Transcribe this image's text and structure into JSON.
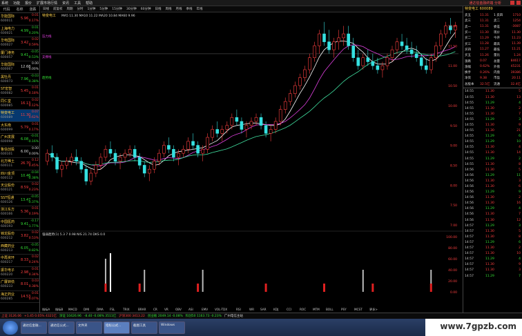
{
  "menubar": {
    "items": [
      "系统",
      "功能",
      "报价",
      "扩展市场行情",
      "资讯",
      "工具",
      "帮助"
    ],
    "brand": "通达信金融终端 分析"
  },
  "left_header": [
    "代码",
    "名称",
    "涨跌"
  ],
  "stocks": [
    {
      "name": "华能国际",
      "code": "600011",
      "price": "5.96",
      "chg": "0.01",
      "pct": "0.17%",
      "dir": "up"
    },
    {
      "name": "上海电力",
      "code": "600021",
      "price": "4.99",
      "chg": "0.01",
      "pct": "0.20%",
      "dir": "dn"
    },
    {
      "name": "华电国际",
      "code": "600027",
      "price": "3.42",
      "chg": "0.02",
      "pct": "0.59%",
      "dir": "up"
    },
    {
      "name": "厦门港务",
      "code": "600057",
      "price": "9.41",
      "chg": "-0.05",
      "pct": "-0.53%",
      "dir": "dn"
    },
    {
      "name": "华能国际",
      "code": "600067",
      "price": "12.68",
      "chg": "0.00",
      "pct": "0.00%",
      "dir": "fl"
    },
    {
      "name": "黑牡丹",
      "code": "600073",
      "price": "7.96",
      "chg": "-0.03",
      "pct": "-0.38%",
      "dir": "dn"
    },
    {
      "name": "ST宏智",
      "code": "600082",
      "price": "5.45",
      "chg": "0.01",
      "pct": "0.18%",
      "dir": "up"
    },
    {
      "name": "同仁堂",
      "code": "600085",
      "price": "16.13",
      "chg": "0.02",
      "pct": "0.12%",
      "dir": "up"
    },
    {
      "name": "特变电工",
      "code": "600089",
      "price": "11.30",
      "chg": "0.07",
      "pct": "0.62%",
      "dir": "up",
      "selected": true
    },
    {
      "name": "大东南",
      "code": "600099",
      "price": "5.79",
      "chg": "0.01",
      "pct": "0.17%",
      "dir": "up"
    },
    {
      "name": "广州发展",
      "code": "600098",
      "price": "6.08",
      "chg": "-0.01",
      "pct": "-0.16%",
      "dir": "dn"
    },
    {
      "name": "鲁信创投",
      "code": "600101",
      "price": "6.00",
      "chg": "0.00",
      "pct": "0.00%",
      "dir": "fl"
    },
    {
      "name": "北方稀土",
      "code": "600111",
      "price": "26.70",
      "chg": "0.12",
      "pct": "0.45%",
      "dir": "up"
    },
    {
      "name": "四川金顶",
      "code": "600112",
      "price": "10.46",
      "chg": "-0.04",
      "pct": "-0.38%",
      "dir": "dn"
    },
    {
      "name": "天业股份",
      "code": "600121",
      "price": "8.59",
      "chg": "0.02",
      "pct": "0.23%",
      "dir": "up"
    },
    {
      "name": "SST恒通",
      "code": "600126",
      "price": "13.47",
      "chg": "-0.05",
      "pct": "-0.37%",
      "dir": "dn"
    },
    {
      "name": "浙江东方",
      "code": "600166",
      "price": "5.36",
      "chg": "0.01",
      "pct": "0.19%",
      "dir": "up"
    },
    {
      "name": "中国医药",
      "code": "600193",
      "price": "9.41",
      "chg": "-0.17",
      "pct": "-1.77%",
      "dir": "dn"
    },
    {
      "name": "锦龙股份",
      "code": "600212",
      "price": "3.82",
      "chg": "0.02",
      "pct": "0.53%",
      "dir": "up"
    },
    {
      "name": "西藏药业",
      "code": "600213",
      "price": "6.05",
      "chg": "-0.05",
      "pct": "-0.82%",
      "dir": "dn"
    },
    {
      "name": "中再资环",
      "code": "600217",
      "price": "8.33",
      "chg": "0.02",
      "pct": "0.24%",
      "dir": "up"
    },
    {
      "name": "振华电子",
      "code": "600220",
      "price": "2.98",
      "chg": "0.01",
      "pct": "0.34%",
      "dir": "up"
    },
    {
      "name": "广厦转债",
      "code": "600233",
      "price": "8.01",
      "chg": "0.03",
      "pct": "0.38%",
      "dir": "up"
    },
    {
      "name": "海正药业",
      "code": "600285",
      "price": "14.53",
      "chg": "0.01",
      "pct": "0.07%",
      "dir": "up"
    }
  ],
  "chart_toolbar": [
    "日线",
    "前复权",
    "周期",
    "分时",
    "1分钟",
    "5分钟",
    "15分钟",
    "30分钟",
    "60分钟",
    "日线",
    "周线",
    "月线",
    "季线",
    "年线"
  ],
  "chart_info": {
    "title": "特变电工",
    "ma_line": "MA5 11.30  MA10 11.22  MA20 10.84  MA60 9.96",
    "indicator_line": "强弱趋势(1)  5.3  7  0.98  NIS  21.74  DKS  0.0",
    "labels_left": [
      "压力线",
      "支撑线",
      "趋势线"
    ]
  },
  "price_axis": [
    "12.00",
    "11.50",
    "11.00",
    "10.50",
    "10.00",
    "9.50",
    "9.00",
    "8.50",
    "8.00",
    "7.50",
    "7.00"
  ],
  "indicator_axis": [
    "100.00",
    "80.00",
    "60.00",
    "40.00",
    "20.00",
    "0.00"
  ],
  "bottom_tabs": [
    "指标A",
    "指标B",
    "MACD",
    "DMI",
    "DMA",
    "FSL",
    "TRIX",
    "BRAR",
    "CR",
    "VR",
    "OBV",
    "ASI",
    "EMV",
    "VOL-TDX",
    "RSI",
    "WR",
    "SAR",
    "KDJ",
    "CCI",
    "ROC",
    "MTM",
    "BOLL",
    "PSY",
    "MCST",
    "更多>"
  ],
  "quote": {
    "name": "特变电工 600089",
    "rows": [
      {
        "a": "卖五",
        "b": "11.31",
        "c": "1 卖四",
        "d": "1710"
      },
      {
        "a": "卖三",
        "b": "11.31",
        "c": "卖二",
        "d": "1254"
      },
      {
        "a": "卖一",
        "b": "11.31",
        "c": "委差",
        "d": "-3087"
      },
      {
        "a": "买一",
        "b": "11.30",
        "c": "现价",
        "d": "11.30"
      },
      {
        "a": "买二",
        "b": "11.29",
        "c": "今开",
        "d": "11.23"
      },
      {
        "a": "买三",
        "b": "11.28",
        "c": "最高",
        "d": "11.39"
      },
      {
        "a": "买四",
        "b": "11.27",
        "c": "最低",
        "d": "11.21"
      },
      {
        "a": "买五",
        "b": "11.26",
        "c": "量比",
        "d": "1.24"
      },
      {
        "a": "涨跌",
        "b": "0.07",
        "c": "总量",
        "d": "84617"
      },
      {
        "a": "涨幅",
        "b": "0.62%",
        "c": "外盘",
        "d": "45231"
      },
      {
        "a": "换手",
        "b": "0.26%",
        "c": "内盘",
        "d": "39386"
      },
      {
        "a": "净资",
        "b": "9.38",
        "c": "市盈",
        "d": "20.11"
      },
      {
        "a": "总股本",
        "b": "32.5亿",
        "c": "流通",
        "d": "32.4亿"
      }
    ],
    "ticks": [
      {
        "t": "14:55",
        "p": "11.30",
        "v": "5",
        "dir": "up"
      },
      {
        "t": "14:55",
        "p": "11.30",
        "v": "13",
        "dir": "up"
      },
      {
        "t": "14:55",
        "p": "11.29",
        "v": "4",
        "dir": "dn"
      },
      {
        "t": "14:55",
        "p": "11.30",
        "v": "2",
        "dir": "up"
      },
      {
        "t": "14:55",
        "p": "11.30",
        "v": "7",
        "dir": "up"
      },
      {
        "t": "14:55",
        "p": "11.29",
        "v": "3",
        "dir": "dn"
      },
      {
        "t": "14:55",
        "p": "11.30",
        "v": "9",
        "dir": "up"
      },
      {
        "t": "14:55",
        "p": "11.30",
        "v": "21",
        "dir": "up"
      },
      {
        "t": "14:55",
        "p": "11.29",
        "v": "6",
        "dir": "dn"
      },
      {
        "t": "14:55",
        "p": "11.29",
        "v": "10",
        "dir": "dn"
      },
      {
        "t": "14:55",
        "p": "11.30",
        "v": "4",
        "dir": "up"
      },
      {
        "t": "14:55",
        "p": "11.30",
        "v": "14",
        "dir": "up"
      },
      {
        "t": "14:55",
        "p": "11.29",
        "v": "2",
        "dir": "dn"
      },
      {
        "t": "14:55",
        "p": "11.30",
        "v": "8",
        "dir": "up"
      },
      {
        "t": "14:56",
        "p": "11.30",
        "v": "5",
        "dir": "up"
      },
      {
        "t": "14:56",
        "p": "11.29",
        "v": "11",
        "dir": "dn"
      },
      {
        "t": "14:56",
        "p": "11.30",
        "v": "3",
        "dir": "up"
      },
      {
        "t": "14:56",
        "p": "11.30",
        "v": "6",
        "dir": "up"
      },
      {
        "t": "14:56",
        "p": "11.29",
        "v": "9",
        "dir": "dn"
      },
      {
        "t": "14:56",
        "p": "11.30",
        "v": "2",
        "dir": "up"
      },
      {
        "t": "14:56",
        "p": "11.30",
        "v": "16",
        "dir": "up"
      },
      {
        "t": "14:56",
        "p": "11.29",
        "v": "4",
        "dir": "dn"
      },
      {
        "t": "14:56",
        "p": "11.30",
        "v": "7",
        "dir": "up"
      },
      {
        "t": "14:56",
        "p": "11.30",
        "v": "12",
        "dir": "up"
      },
      {
        "t": "14:57",
        "p": "11.29",
        "v": "3",
        "dir": "dn"
      },
      {
        "t": "14:57",
        "p": "11.30",
        "v": "5",
        "dir": "up"
      },
      {
        "t": "14:57",
        "p": "11.30",
        "v": "8",
        "dir": "up"
      },
      {
        "t": "14:57",
        "p": "11.29",
        "v": "6",
        "dir": "dn"
      },
      {
        "t": "14:57",
        "p": "11.30",
        "v": "2",
        "dir": "up"
      },
      {
        "t": "14:57",
        "p": "11.30",
        "v": "10",
        "dir": "up"
      },
      {
        "t": "14:57",
        "p": "11.29",
        "v": "4",
        "dir": "dn"
      },
      {
        "t": "14:57",
        "p": "11.30",
        "v": "9",
        "dir": "up"
      },
      {
        "t": "14:57",
        "p": "11.30",
        "v": "3",
        "dir": "up"
      },
      {
        "t": "14:57",
        "p": "11.29",
        "v": "7",
        "dir": "dn"
      }
    ]
  },
  "statusbar": [
    {
      "text": "上证 3126.06",
      "dir": "up"
    },
    {
      "text": "+1.45  0.05%  4321亿",
      "dir": "up"
    },
    {
      "text": "深证 10426.96",
      "dir": "dn"
    },
    {
      "text": "-8.40  -0.08%  3511亿",
      "dir": "dn"
    },
    {
      "text": "沪深300 3413.22",
      "dir": "up"
    },
    {
      "text": "创业板 2049.14  -0.08%",
      "dir": "dn"
    },
    {
      "text": "科创50 1163.73  -0.23%",
      "dir": "dn"
    },
    {
      "text": "广州电信主站",
      "dir": "fl"
    }
  ],
  "taskbar": {
    "tasks": [
      "通达信金融...",
      "通达信公式...",
      "文件夹",
      "指标公式...",
      "截图工具",
      "Windows"
    ],
    "watermark": "www.7gpzb.com"
  },
  "chart_data": {
    "type": "candlestick",
    "title": "特变电工",
    "ylim": [
      7.0,
      12.2
    ],
    "candles": [
      [
        8.6,
        8.9,
        8.5,
        8.8
      ],
      [
        8.8,
        9.0,
        8.6,
        8.7
      ],
      [
        8.7,
        8.8,
        8.3,
        8.4
      ],
      [
        8.4,
        8.6,
        8.2,
        8.5
      ],
      [
        8.5,
        8.7,
        8.4,
        8.6
      ],
      [
        8.6,
        8.8,
        8.5,
        8.7
      ],
      [
        8.7,
        8.9,
        8.5,
        8.6
      ],
      [
        8.6,
        8.7,
        8.3,
        8.4
      ],
      [
        8.4,
        8.5,
        8.0,
        8.1
      ],
      [
        8.1,
        8.4,
        8.0,
        8.3
      ],
      [
        8.3,
        8.6,
        8.2,
        8.5
      ],
      [
        8.5,
        8.8,
        8.4,
        8.7
      ],
      [
        8.7,
        9.0,
        8.6,
        8.9
      ],
      [
        8.9,
        9.1,
        8.7,
        8.8
      ],
      [
        8.8,
        8.9,
        8.5,
        8.6
      ],
      [
        8.6,
        8.8,
        8.4,
        8.7
      ],
      [
        8.7,
        8.9,
        8.6,
        8.8
      ],
      [
        8.8,
        9.0,
        8.7,
        8.9
      ],
      [
        8.9,
        9.0,
        8.6,
        8.7
      ],
      [
        8.7,
        8.8,
        8.4,
        8.5
      ],
      [
        8.5,
        8.6,
        8.2,
        8.3
      ],
      [
        8.3,
        8.5,
        8.1,
        8.4
      ],
      [
        8.4,
        8.7,
        8.3,
        8.6
      ],
      [
        8.6,
        8.9,
        8.5,
        8.8
      ],
      [
        8.8,
        9.1,
        8.7,
        9.0
      ],
      [
        9.0,
        9.2,
        8.8,
        8.9
      ],
      [
        8.9,
        9.0,
        8.6,
        8.7
      ],
      [
        8.7,
        8.9,
        8.5,
        8.8
      ],
      [
        8.8,
        9.0,
        8.7,
        8.9
      ],
      [
        8.9,
        9.2,
        8.8,
        9.1
      ],
      [
        9.1,
        9.3,
        8.9,
        9.0
      ],
      [
        9.0,
        9.1,
        8.7,
        8.8
      ],
      [
        8.8,
        9.0,
        8.6,
        8.9
      ],
      [
        8.9,
        9.3,
        8.8,
        9.2
      ],
      [
        9.2,
        9.5,
        9.1,
        9.4
      ],
      [
        9.4,
        9.6,
        9.2,
        9.3
      ],
      [
        9.3,
        9.5,
        9.1,
        9.4
      ],
      [
        9.4,
        9.6,
        9.3,
        9.5
      ],
      [
        9.5,
        9.8,
        9.4,
        9.7
      ],
      [
        9.7,
        9.9,
        9.5,
        9.6
      ],
      [
        9.6,
        9.7,
        9.3,
        9.4
      ],
      [
        9.4,
        9.6,
        9.2,
        9.5
      ],
      [
        9.5,
        9.7,
        9.4,
        9.6
      ],
      [
        9.6,
        9.8,
        9.5,
        9.7
      ],
      [
        9.7,
        9.8,
        9.4,
        9.5
      ],
      [
        9.5,
        9.6,
        9.2,
        9.3
      ],
      [
        9.3,
        9.5,
        9.1,
        9.4
      ],
      [
        9.4,
        9.7,
        9.3,
        9.6
      ],
      [
        9.6,
        10.0,
        9.5,
        9.9
      ],
      [
        9.9,
        10.2,
        9.8,
        10.1
      ],
      [
        10.1,
        10.4,
        10.0,
        10.3
      ],
      [
        10.3,
        10.6,
        10.2,
        10.5
      ],
      [
        10.5,
        10.8,
        10.4,
        10.7
      ],
      [
        10.7,
        11.0,
        10.6,
        10.9
      ],
      [
        10.9,
        11.3,
        10.8,
        11.2
      ],
      [
        11.2,
        11.6,
        11.1,
        11.5
      ],
      [
        11.5,
        11.9,
        11.3,
        11.8
      ],
      [
        11.8,
        12.1,
        11.5,
        11.6
      ],
      [
        11.6,
        11.9,
        11.3,
        11.4
      ],
      [
        11.4,
        11.7,
        11.2,
        11.6
      ],
      [
        11.6,
        11.9,
        11.4,
        11.7
      ],
      [
        11.7,
        12.0,
        11.5,
        11.8
      ],
      [
        11.8,
        12.0,
        11.4,
        11.5
      ],
      [
        11.5,
        11.7,
        11.1,
        11.2
      ],
      [
        11.2,
        11.4,
        10.9,
        11.0
      ],
      [
        11.0,
        11.3,
        10.9,
        11.2
      ],
      [
        11.2,
        11.4,
        11.0,
        11.1
      ],
      [
        11.1,
        11.3,
        10.9,
        11.0
      ],
      [
        11.0,
        11.2,
        10.8,
        10.9
      ],
      [
        10.9,
        11.1,
        10.7,
        11.0
      ],
      [
        11.0,
        11.3,
        10.9,
        11.2
      ],
      [
        11.2,
        11.5,
        11.1,
        11.4
      ],
      [
        11.4,
        11.7,
        11.3,
        11.6
      ],
      [
        11.6,
        11.8,
        11.4,
        11.5
      ],
      [
        11.5,
        11.7,
        11.3,
        11.4
      ],
      [
        11.4,
        11.6,
        11.2,
        11.3
      ],
      [
        11.3,
        11.5,
        11.1,
        11.2
      ],
      [
        11.2,
        11.3,
        10.9,
        11.0
      ],
      [
        11.0,
        11.2,
        10.8,
        10.9
      ],
      [
        10.9,
        11.3,
        10.8,
        11.2
      ],
      [
        11.2,
        11.6,
        11.1,
        11.5
      ],
      [
        11.5,
        11.9,
        11.4,
        11.8
      ],
      [
        11.8,
        12.1,
        11.7,
        12.0
      ],
      [
        12.0,
        12.2,
        11.8,
        11.9
      ],
      [
        11.9,
        12.1,
        11.7,
        12.0
      ]
    ],
    "signal_bars": [
      {
        "i": 12,
        "value": 60,
        "color": "#bbbbbb"
      },
      {
        "i": 13,
        "value": 70,
        "color": "#ffffff"
      },
      {
        "i": 20,
        "value": 40,
        "color": "#bbbbbb"
      },
      {
        "i": 32,
        "value": 40,
        "color": "#bbbbbb"
      },
      {
        "i": 65,
        "value": 40,
        "color": "#bbbbbb"
      },
      {
        "i": 79,
        "value": 40,
        "color": "#bbbbbb"
      }
    ],
    "red_markers": [
      12,
      19,
      31,
      45,
      57,
      67,
      79
    ]
  }
}
